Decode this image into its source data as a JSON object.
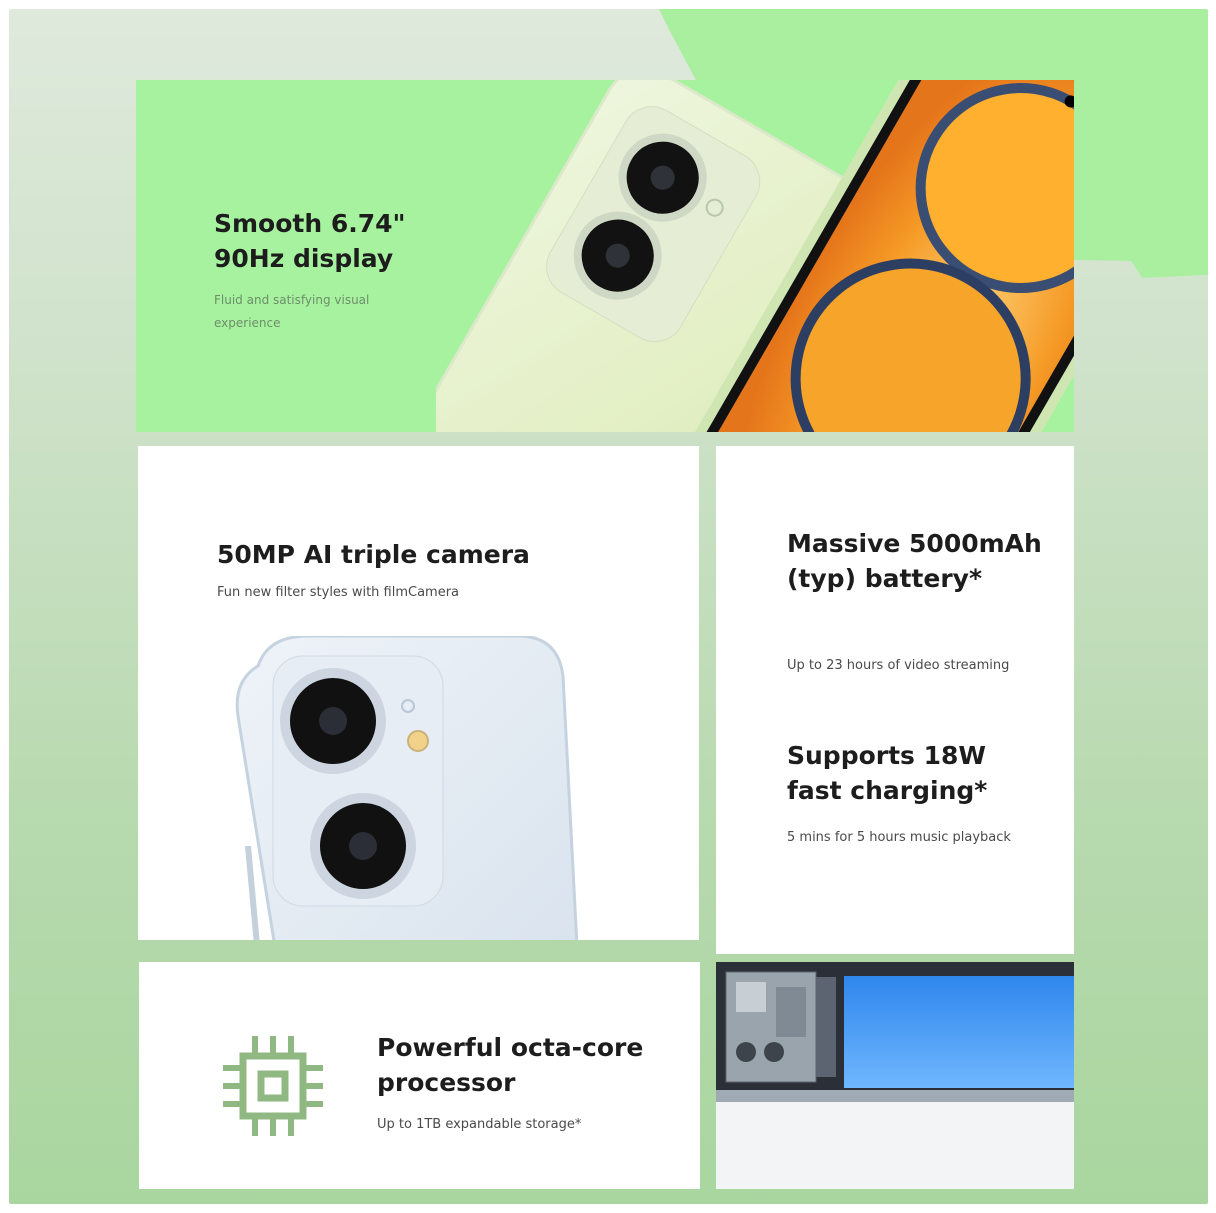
{
  "colors": {
    "accent_green": "#a6f29f",
    "background_green": "#b6d9ad",
    "phone_screen_orange": "#f39a2b",
    "battery_blue": "#3f93ef",
    "chip_icon_green": "#8fb882"
  },
  "display": {
    "title": "Smooth 6.74\" 90Hz display",
    "subtitle": "Fluid and satisfying visual experience"
  },
  "camera": {
    "title": "50MP AI triple camera",
    "subtitle": "Fun new filter styles with filmCamera"
  },
  "battery": {
    "title": "Massive 5000mAh (typ) battery*",
    "subtitle": "Up to 23 hours of video streaming",
    "charging_title": "Supports 18W fast charging*",
    "charging_subtitle": "5 mins for 5 hours music playback"
  },
  "processor": {
    "icon": "cpu-chip-icon",
    "title": "Powerful octa-core processor",
    "subtitle": "Up to 1TB expandable storage*"
  }
}
